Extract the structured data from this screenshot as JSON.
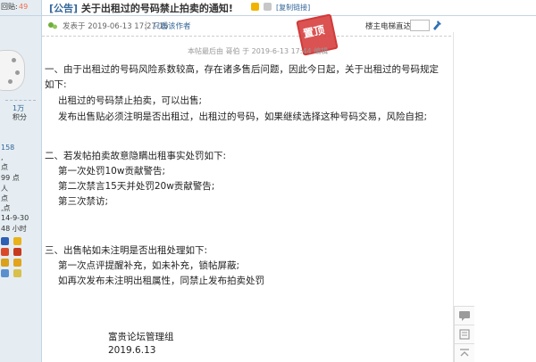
{
  "user_panel": {
    "top_label": "回贴:",
    "top_value": "49",
    "username": "",
    "stat_threads_value": "1万",
    "stat_credits_label": "积分",
    "info_lines": [
      "158",
      ",",
      "点",
      "99 点",
      "人",
      "点",
      ",点",
      "14-9-30",
      "48 小时"
    ]
  },
  "thread": {
    "prefix": "[公告]",
    "title": "关于出租过的号码禁止拍卖的通知!",
    "copy_link": "[复制链接]",
    "post_time": "发表于 2019-06-13 17:27:16",
    "author_only": "只看该作者",
    "floor_label": "楼主",
    "jump_label": "电梯直达",
    "floor_input_value": "",
    "stamp_text": "置顶"
  },
  "post": {
    "edit_note": "本帖最后由 哥伯 于 2019-6-13 17:44 编辑",
    "paragraphs": [
      "一、由于出租过的号码风险系数较高，存在诸多售后问题，因此今日起，关于出租过的号码规定",
      "如下:",
      "出租过的号码禁止拍卖，可以出售;",
      "发布出售贴必须注明是否出租过，出租过的号码，如果继续选择这种号码交易，风险自担;",
      "二、若发帖拍卖故意隐瞒出租事实处罚如下:",
      "第一次处罚10w贡献警告;",
      "第二次禁言15天并处罚20w贡献警告;",
      "第三次禁访;",
      "三、出售帖如未注明是否出租处理如下:",
      "第一次点评提醒补充，如未补充，锁帖屏蔽;",
      "如再次发布未注明出租属性，同禁止发布拍卖处罚"
    ],
    "signature_name": "富贵论坛管理组",
    "signature_date": "2019.6.13"
  },
  "colors": {
    "link": "#336699",
    "accent_red": "#d23a3a",
    "panel_bg": "#e5edf2",
    "border": "#c2d5e3"
  },
  "icons": [
    "online-status-icon",
    "go-floor-icon",
    "comment-icon",
    "list-icon",
    "back-to-top-icon"
  ]
}
